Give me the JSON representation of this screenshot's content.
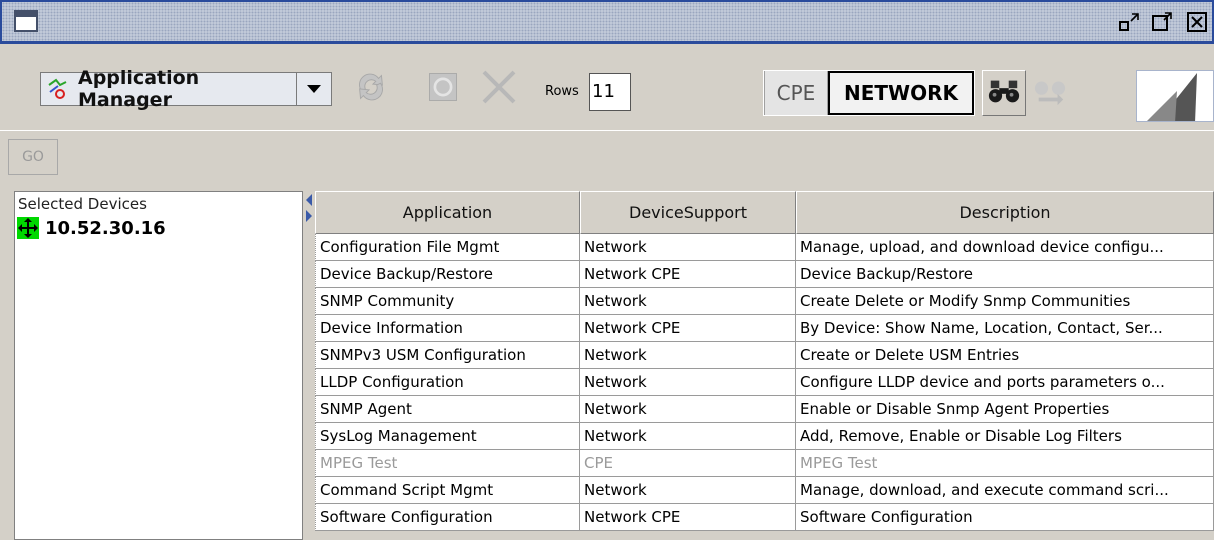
{
  "colors": {
    "titlebar_border": "#2a4b9c",
    "window_bg": "#d4d0c8",
    "device_icon": "#00d800",
    "disabled_text": "#9a9a9a"
  },
  "window": {
    "icon": "window-icon",
    "controls": [
      "restore-icon",
      "maximize-icon",
      "close-icon"
    ]
  },
  "toolbar": {
    "app_selector_label": "Application Manager",
    "app_selector_icon": "app-manager-icon",
    "refresh_icon": "refresh-icon",
    "stop_icon": "stop-icon",
    "cancel_icon": "x-icon",
    "rows_label": "Rows",
    "rows_value": "11",
    "mode_cpe": "CPE",
    "mode_network": "NETWORK",
    "selected_mode": "NETWORK",
    "find_icon": "binoculars-icon",
    "find_next_icon": "binoculars-arrow-icon"
  },
  "gobar": {
    "go_label": "GO"
  },
  "left_panel": {
    "header": "Selected Devices",
    "devices": [
      {
        "label": "10.52.30.16",
        "icon": "device-move-icon"
      }
    ]
  },
  "table": {
    "columns": [
      "Application",
      "DeviceSupport",
      "Description"
    ],
    "rows": [
      {
        "application": "Configuration File Mgmt",
        "device_support": "Network",
        "description": "Manage, upload, and download device configu...",
        "enabled": true
      },
      {
        "application": "Device Backup/Restore",
        "device_support": "Network CPE",
        "description": "Device Backup/Restore",
        "enabled": true
      },
      {
        "application": "SNMP Community",
        "device_support": "Network",
        "description": "Create Delete or Modify Snmp Communities",
        "enabled": true
      },
      {
        "application": "Device Information",
        "device_support": "Network CPE",
        "description": "By Device: Show Name, Location, Contact, Ser...",
        "enabled": true
      },
      {
        "application": "SNMPv3 USM Configuration",
        "device_support": "Network",
        "description": "Create or Delete USM Entries",
        "enabled": true
      },
      {
        "application": "LLDP Configuration",
        "device_support": "Network",
        "description": "Configure LLDP device and ports parameters o...",
        "enabled": true
      },
      {
        "application": "SNMP Agent",
        "device_support": "Network",
        "description": "Enable or Disable Snmp Agent Properties",
        "enabled": true
      },
      {
        "application": "SysLog Management",
        "device_support": "Network",
        "description": "Add, Remove, Enable or Disable Log Filters",
        "enabled": true
      },
      {
        "application": "MPEG Test",
        "device_support": "CPE",
        "description": "MPEG Test",
        "enabled": false
      },
      {
        "application": "Command Script Mgmt",
        "device_support": "Network",
        "description": "Manage, download, and execute command scri...",
        "enabled": true
      },
      {
        "application": "Software Configuration",
        "device_support": "Network CPE",
        "description": "Software Configuration",
        "enabled": true
      }
    ]
  }
}
